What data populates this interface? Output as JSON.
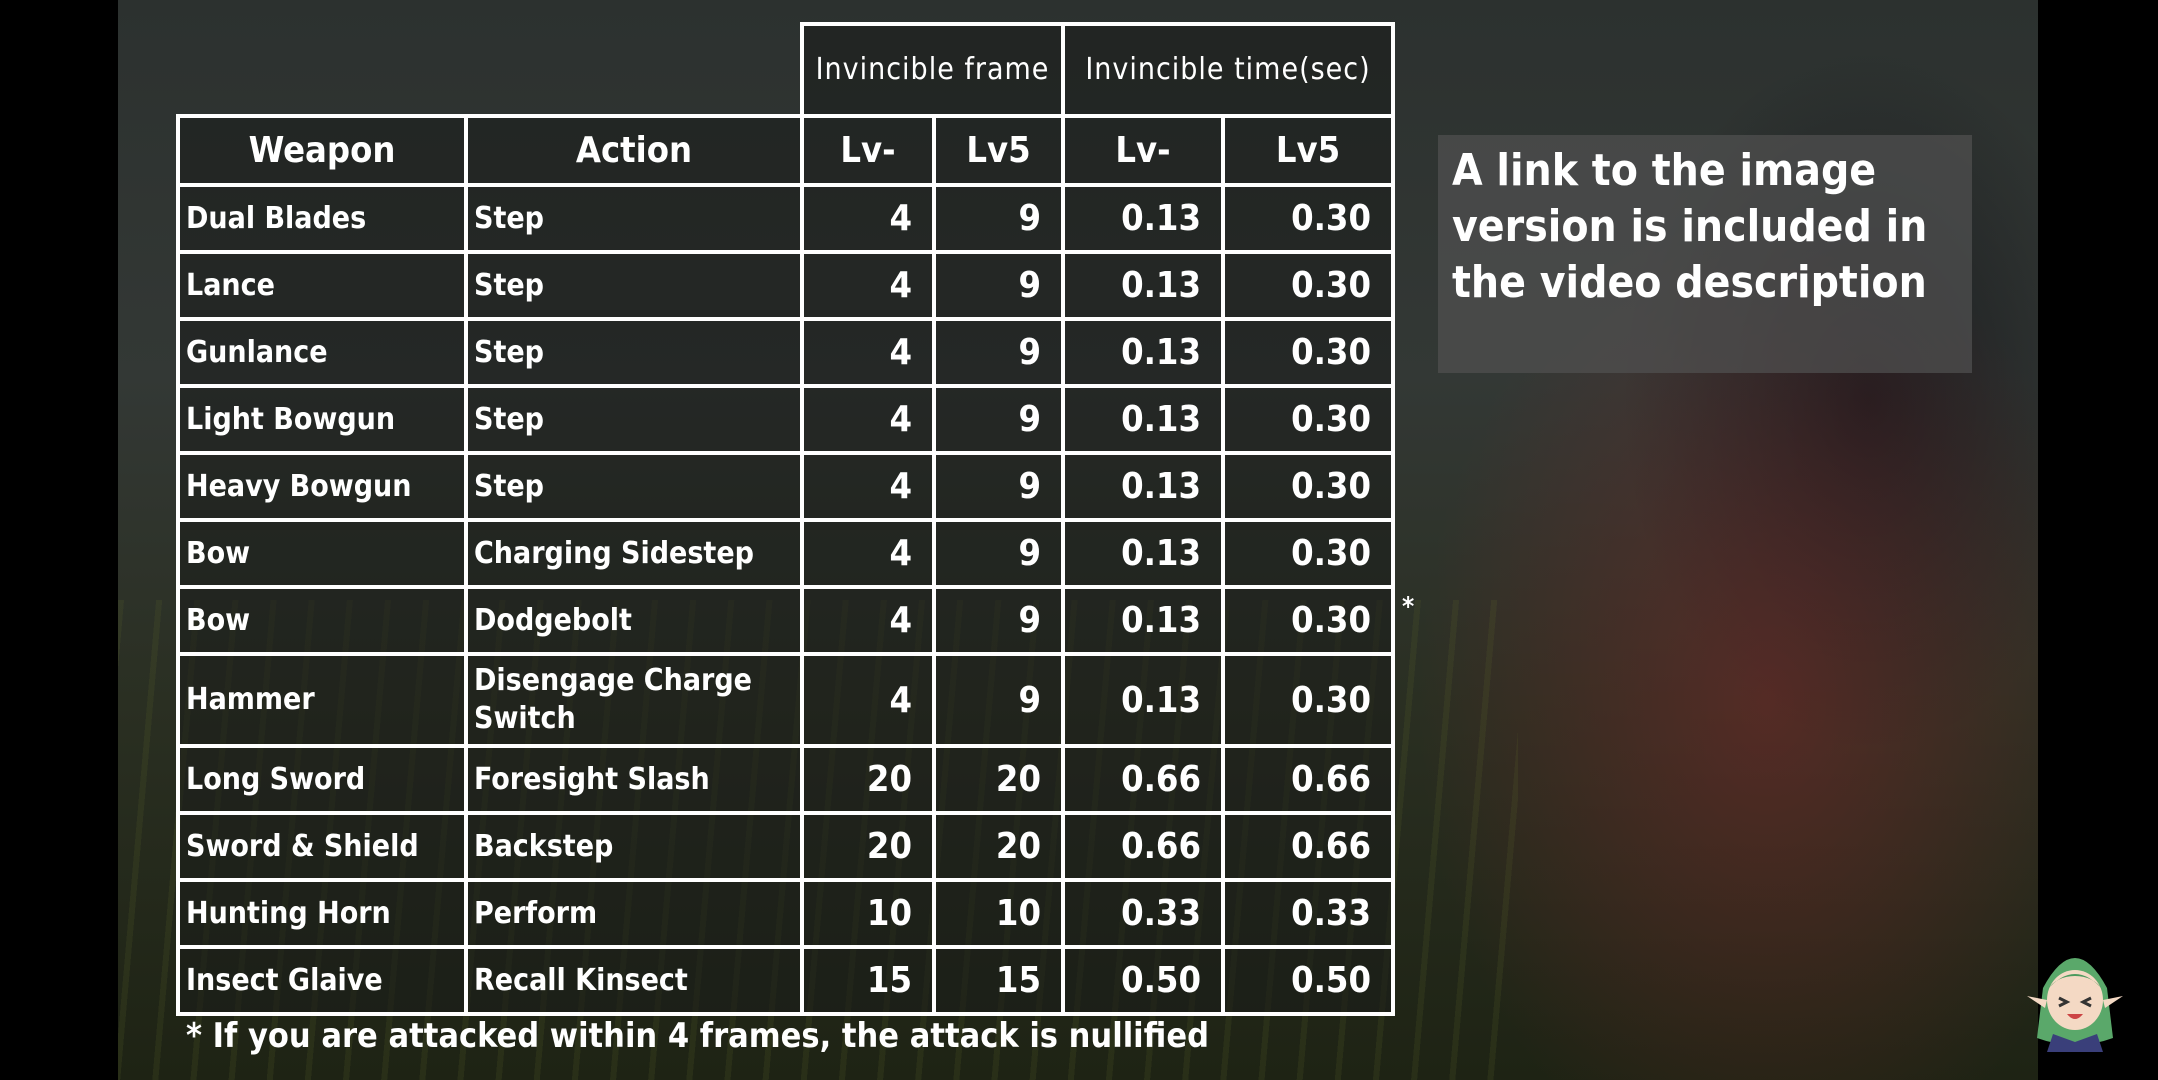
{
  "table": {
    "group_headers": [
      "Invincible frame",
      "Invincible time(sec)"
    ],
    "columns": [
      "Weapon",
      "Action",
      "Lv-",
      "Lv5",
      "Lv-",
      "Lv5"
    ],
    "rows": [
      [
        "Dual Blades",
        "Step",
        "4",
        "9",
        "0.13",
        "0.30"
      ],
      [
        "Lance",
        "Step",
        "4",
        "9",
        "0.13",
        "0.30"
      ],
      [
        "Gunlance",
        "Step",
        "4",
        "9",
        "0.13",
        "0.30"
      ],
      [
        "Light Bowgun",
        "Step",
        "4",
        "9",
        "0.13",
        "0.30"
      ],
      [
        "Heavy Bowgun",
        "Step",
        "4",
        "9",
        "0.13",
        "0.30"
      ],
      [
        "Bow",
        "Charging Sidestep",
        "4",
        "9",
        "0.13",
        "0.30"
      ],
      [
        "Bow",
        "Dodgebolt",
        "4",
        "9",
        "0.13",
        "0.30"
      ],
      [
        "Hammer",
        "Disengage Charge Switch",
        "4",
        "9",
        "0.13",
        "0.30"
      ],
      [
        "Long Sword",
        "Foresight Slash",
        "20",
        "20",
        "0.66",
        "0.66"
      ],
      [
        "Sword & Shield",
        "Backstep",
        "20",
        "20",
        "0.66",
        "0.66"
      ],
      [
        "Hunting Horn",
        "Perform",
        "10",
        "10",
        "0.33",
        "0.33"
      ],
      [
        "Insect Glaive",
        "Recall Kinsect",
        "15",
        "15",
        "0.50",
        "0.50"
      ]
    ],
    "row_marker": "*"
  },
  "footnote": "* If you are attacked within 4 frames, the attack is nullified",
  "info_box": "A link to the image version is included in the video description",
  "avatar_icon": "chibi-character-icon"
}
